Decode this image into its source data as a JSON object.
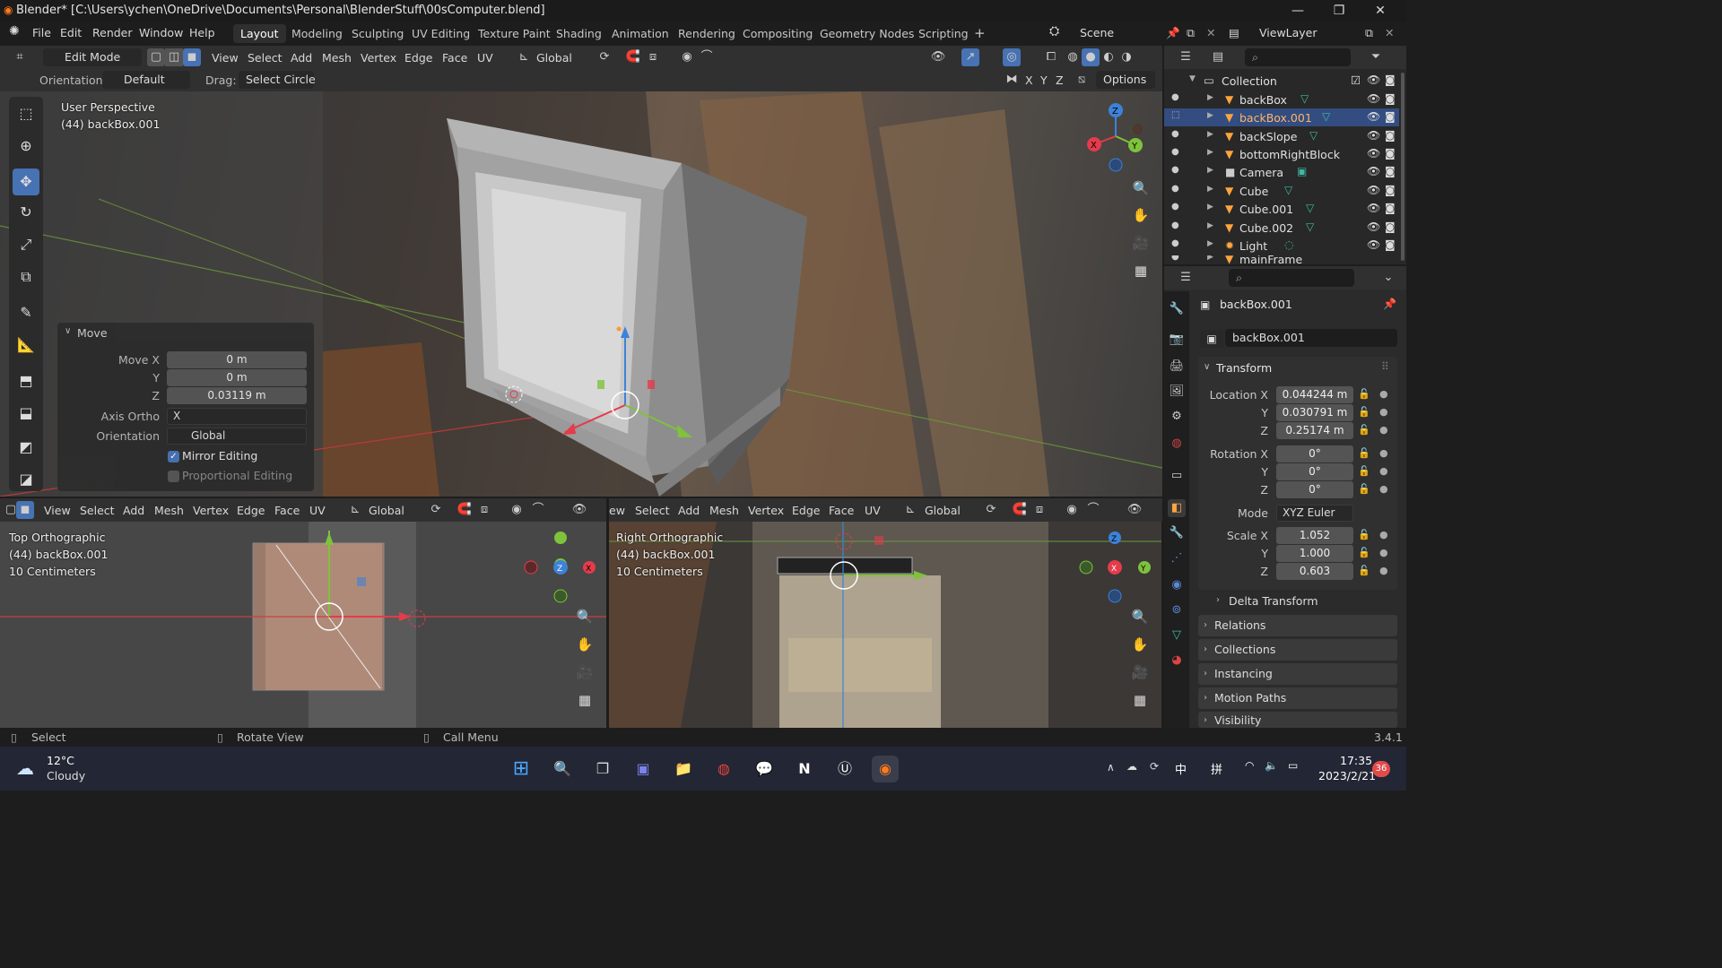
{
  "window": {
    "title": "Blender* [C:\\Users\\ychen\\OneDrive\\Documents\\Personal\\BlenderStuff\\00sComputer.blend]",
    "min": "—",
    "max": "❐",
    "close": "✕"
  },
  "menu": [
    "File",
    "Edit",
    "Render",
    "Window",
    "Help"
  ],
  "workspaces": [
    "Layout",
    "Modeling",
    "Sculpting",
    "UV Editing",
    "Texture Paint",
    "Shading",
    "Animation",
    "Rendering",
    "Compositing",
    "Geometry Nodes",
    "Scripting",
    "+"
  ],
  "scene": "Scene",
  "viewlayer": "ViewLayer",
  "header3d": {
    "mode": "Edit Mode",
    "menus": [
      "View",
      "Select",
      "Add",
      "Mesh",
      "Vertex",
      "Edge",
      "Face",
      "UV"
    ],
    "transform_orientation": "Global"
  },
  "toolsettings": {
    "orientation_label": "Orientation:",
    "orientation_value": "Default",
    "drag_label": "Drag:",
    "drag_value": "Select Circle",
    "axes": [
      "X",
      "Y",
      "Z"
    ],
    "options": "Options"
  },
  "viewport_main": {
    "line1": "User Perspective",
    "line2": "(44) backBox.001"
  },
  "move_panel": {
    "title": "Move",
    "move_x_label": "Move X",
    "move_x": "0 m",
    "y_label": "Y",
    "y": "0 m",
    "z_label": "Z",
    "z": "0.03119 m",
    "axis_ortho_label": "Axis Ortho",
    "axis_ortho": "X",
    "orientation_label": "Orientation",
    "orientation": "Global",
    "mirror_editing": "Mirror Editing",
    "mirror_checked": true,
    "proportional_editing": "Proportional Editing",
    "proportional_checked": false
  },
  "header_bottom_left": {
    "menus": [
      "View",
      "Select",
      "Add",
      "Mesh",
      "Vertex",
      "Edge",
      "Face",
      "UV"
    ],
    "orientation": "Global"
  },
  "header_bottom_right": {
    "menus": [
      "ew",
      "Select",
      "Add",
      "Mesh",
      "Vertex",
      "Edge",
      "Face",
      "UV"
    ],
    "orientation": "Global"
  },
  "viewport_top": {
    "line1": "Top Orthographic",
    "line2": "(44) backBox.001",
    "line3": "10 Centimeters"
  },
  "viewport_right": {
    "line1": "Right Orthographic",
    "line2": "(44) backBox.001",
    "line3": "10 Centimeters"
  },
  "outliner": {
    "collection": "Collection",
    "items": [
      {
        "name": "backBox",
        "selected": false
      },
      {
        "name": "backBox.001",
        "selected": true
      },
      {
        "name": "backSlope",
        "selected": false
      },
      {
        "name": "bottomRightBlock",
        "selected": false
      },
      {
        "name": "Camera",
        "selected": false
      },
      {
        "name": "Cube",
        "selected": false
      },
      {
        "name": "Cube.001",
        "selected": false
      },
      {
        "name": "Cube.002",
        "selected": false
      },
      {
        "name": "Light",
        "selected": false
      },
      {
        "name": "mainFrame",
        "selected": false
      }
    ]
  },
  "properties": {
    "object_name": "backBox.001",
    "data_name": "backBox.001",
    "transform": "Transform",
    "location_label": "Location X",
    "location": [
      "0.044244 m",
      "0.030791 m",
      "0.25174 m"
    ],
    "rotation_label": "Rotation X",
    "rotation": [
      "0°",
      "0°",
      "0°"
    ],
    "mode_label": "Mode",
    "mode": "XYZ Euler",
    "scale_label": "Scale X",
    "scale": [
      "1.052",
      "1.000",
      "0.603"
    ],
    "axis_y": "Y",
    "axis_z": "Z",
    "sections": [
      "Delta Transform",
      "Relations",
      "Collections",
      "Instancing",
      "Motion Paths",
      "Visibility"
    ]
  },
  "status": {
    "select": "Select",
    "rotate": "Rotate View",
    "call_menu": "Call Menu",
    "version": "3.4.1"
  },
  "taskbar": {
    "temp": "12°C",
    "weather": "Cloudy",
    "time": "17:35",
    "date": "2023/2/21",
    "ime1": "中",
    "ime2": "拼",
    "badge": "36"
  },
  "colors": {
    "accent": "#4772b3",
    "selected_row": "#334d80",
    "mesh_orange": "#ffa53d",
    "axis_x": "#e53b4b",
    "axis_y": "#7fc23b",
    "axis_z": "#3d82d8"
  }
}
